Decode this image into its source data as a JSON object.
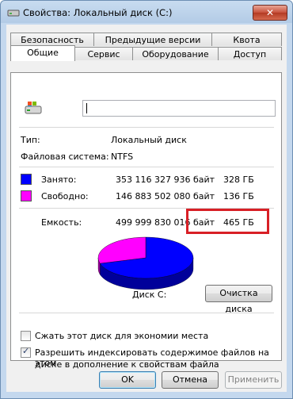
{
  "window": {
    "title": "Свойства: Локальный диск (C:)",
    "close_label": "✕"
  },
  "tabs": {
    "row_back": [
      "Безопасность",
      "Предыдущие версии",
      "Квота"
    ],
    "row_front": [
      "Общие",
      "Сервис",
      "Оборудование",
      "Доступ"
    ],
    "active": "Общие"
  },
  "general": {
    "drive_name_value": "",
    "type_label": "Тип:",
    "type_value": "Локальный диск",
    "fs_label": "Файловая система:",
    "fs_value": "NTFS",
    "used_label": "Занято:",
    "used_bytes": "353 116 327 936 байт",
    "used_gb": "328 ГБ",
    "free_label": "Свободно:",
    "free_bytes": "146 883 502 080 байт",
    "free_gb": "136 ГБ",
    "capacity_label": "Емкость:",
    "capacity_bytes": "499 999 830 016 байт",
    "capacity_gb": "465 ГБ",
    "disk_label": "Диск C:",
    "cleanup_button": "Очистка диска",
    "compress_label": "Сжать этот диск для экономии места",
    "compress_checked": false,
    "index_label_line1": "Разрешить индексировать содержимое файлов на этом",
    "index_label_line2": "диске в дополнение к свойствам файла",
    "index_checked": true,
    "used_fraction": 0.706,
    "colors": {
      "used": "#0000ff",
      "free": "#ff00ff"
    }
  },
  "footer": {
    "ok": "OK",
    "cancel": "Отмена",
    "apply": "Применить"
  }
}
